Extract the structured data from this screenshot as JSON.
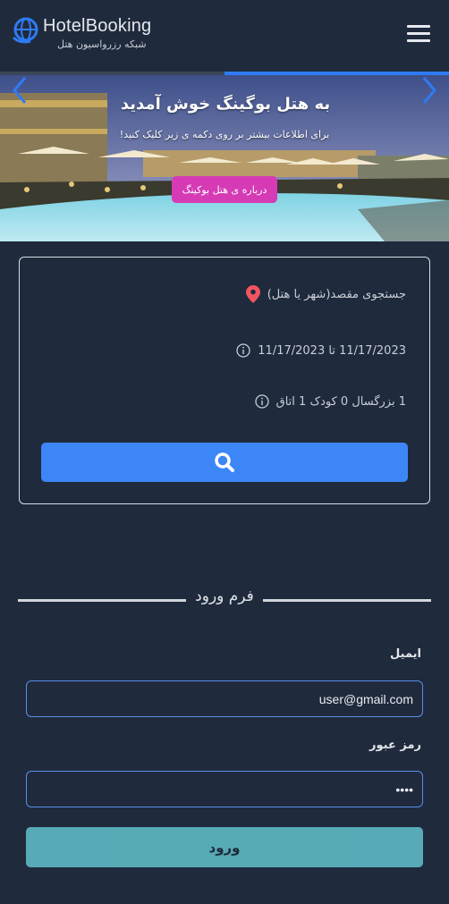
{
  "header": {
    "brand": "HotelBooking",
    "subtitle": "شبکه رزرواسیون هتل",
    "logo_icon": "globe-logo-icon",
    "menu_icon": "hamburger-menu-icon"
  },
  "slider": {
    "progress": 0.5,
    "title": "به هتل بوگینگ خوش آمدید",
    "subtitle": "برای اطلاعات بیشتر بر روی دکمه ی زیر کلیک کنید!",
    "button_label": "درباره ی هتل بوکینگ",
    "button_color": "#d63ab5"
  },
  "search": {
    "destination_placeholder": "جستجوی مقصد(شهر یا هتل)",
    "dates": "11/17/2023 تا 11/17/2023",
    "guests": "1 بزرگسال 0 کودک 1 اتاق",
    "button_color": "#3d86f7"
  },
  "login": {
    "title": "فرم ورود",
    "email_label": "ایمیل",
    "email_value": "user@gmail.com",
    "password_label": "رمز عبور",
    "password_value": "••••",
    "submit_label": "ورود",
    "submit_color": "#5eb9c3"
  }
}
